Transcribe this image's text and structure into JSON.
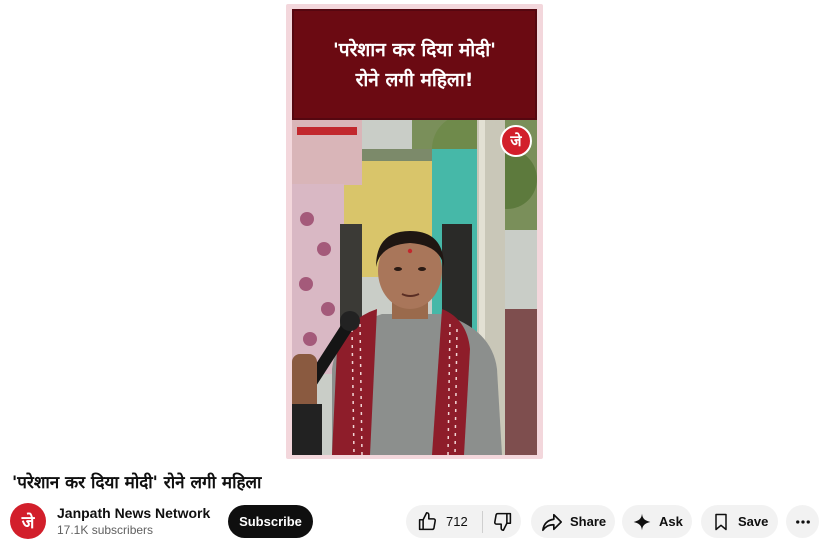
{
  "video": {
    "banner_line1": "'परेशान कर दिया मोदी'",
    "banner_line2": "रोने लगी महिला!",
    "badge_letter": "जे"
  },
  "title": "'परेशान कर दिया मोदी' रोने लगी महिला",
  "channel": {
    "avatar_letter": "जे",
    "name": "Janpath News Network",
    "subscribers": "17.1K subscribers",
    "subscribe_label": "Subscribe"
  },
  "actions": {
    "like_count": "712",
    "share_label": "Share",
    "ask_label": "Ask",
    "save_label": "Save"
  },
  "icons": {
    "like": "thumbs-up-icon",
    "dislike": "thumbs-down-icon",
    "share": "share-arrow-icon",
    "ask": "sparkle-icon",
    "save": "bookmark-icon",
    "more": "more-horizontal-icon"
  },
  "colors": {
    "banner_bg": "#6b0a12",
    "brand_red": "#d21f2b",
    "subscribe_bg": "#0f0f0f",
    "pill_bg": "#f2f2f2"
  }
}
